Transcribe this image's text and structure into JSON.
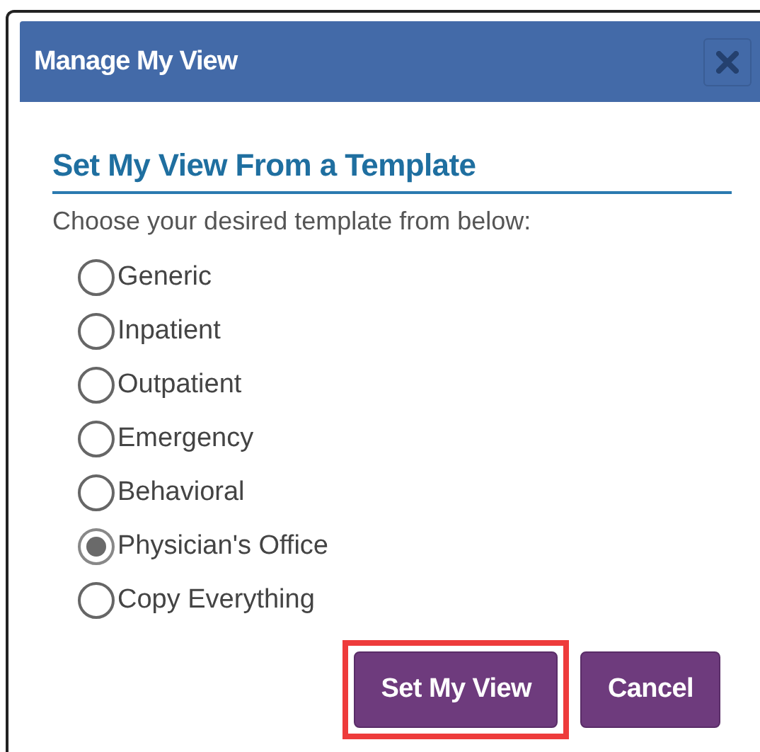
{
  "window": {
    "title": "Manage My View"
  },
  "section": {
    "heading": "Set My View From a Template",
    "prompt": "Choose your desired template from below:"
  },
  "templates": [
    {
      "label": "Generic",
      "selected": false
    },
    {
      "label": "Inpatient",
      "selected": false
    },
    {
      "label": "Outpatient",
      "selected": false
    },
    {
      "label": "Emergency",
      "selected": false
    },
    {
      "label": "Behavioral",
      "selected": false
    },
    {
      "label": "Physician's Office",
      "selected": true
    },
    {
      "label": "Copy Everything",
      "selected": false
    }
  ],
  "buttons": [
    {
      "label": "Set My View",
      "highlighted": true
    },
    {
      "label": "Cancel",
      "highlighted": false
    }
  ]
}
